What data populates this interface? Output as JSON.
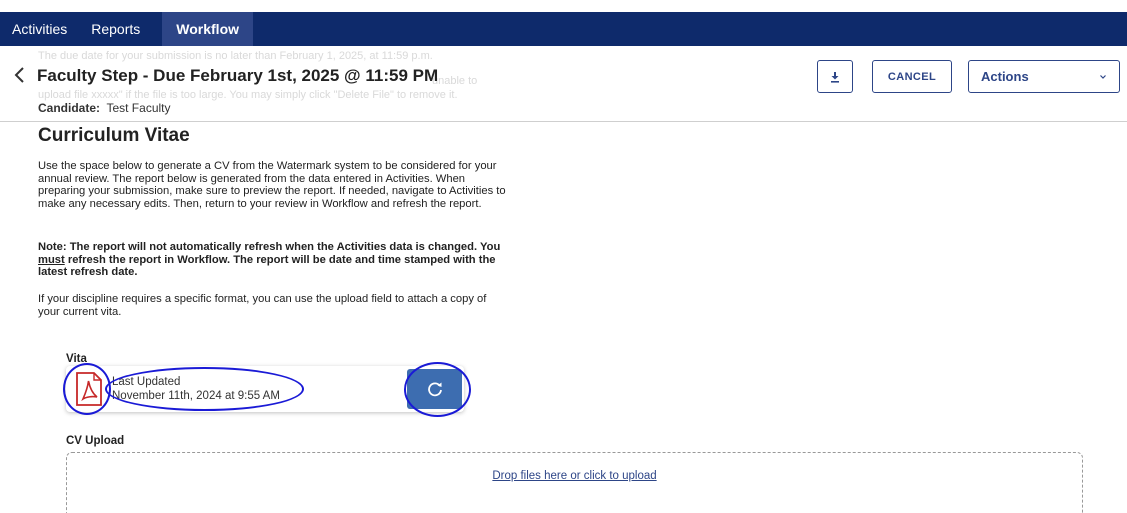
{
  "nav": {
    "tabs": [
      {
        "label": "Activities"
      },
      {
        "label": "Reports"
      },
      {
        "label": "Workflow"
      }
    ],
    "active_tab": "Workflow"
  },
  "header": {
    "ghost_line1": "The due date for your submission is no later than February 1, 2025, at 11:59 p.m.",
    "ghost_line2": "unable to",
    "ghost_line3": "upload file xxxxx\" if the file is too large. You may simply click \"Delete File\" to remove it.",
    "title": "Faculty Step - Due February 1st, 2025 @ 11:59 PM",
    "candidate_label": "Candidate:",
    "candidate_value": "Test Faculty",
    "cancel_label": "CANCEL",
    "actions_label": "Actions"
  },
  "content": {
    "section_title": "Curriculum Vitae",
    "para1": "Use the space below to generate a CV from the Watermark system to be considered for your annual review. The report below is generated from the data entered in Activities. When preparing your submission, make sure to preview the report. If needed, navigate to Activities to make any necessary edits. Then, return to your review in Workflow and refresh the report.",
    "para2_a": "Note: The report will not automatically refresh when the Activities data is changed. You ",
    "para2_must": "must",
    "para2_b": " refresh the report in Workflow. The report will be date and time stamped with the latest refresh date.",
    "para3": "If your discipline requires a specific format, you can use the upload field to attach a copy of your current vita."
  },
  "vita": {
    "label": "Vita",
    "last_updated_label": "Last Updated",
    "last_updated_value": "November 11th, 2024 at 9:55 AM"
  },
  "upload": {
    "label": "CV Upload",
    "drop_text": "Drop files here or click to upload"
  },
  "colors": {
    "nav_bg": "#0e2a6b",
    "nav_active": "#2d4587",
    "accent": "#2d4587",
    "refresh_bg": "#3d6db0",
    "pdf_red": "#c62828",
    "annotation": "#1a1ad6"
  },
  "icons": {
    "back": "chevron-left-icon",
    "download": "download-icon",
    "actions_chevron": "chevron-down-icon",
    "pdf": "pdf-file-icon",
    "refresh": "refresh-icon"
  }
}
